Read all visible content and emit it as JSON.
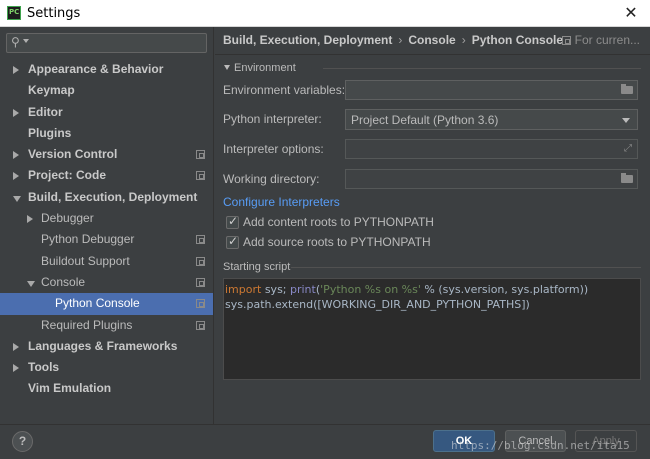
{
  "window": {
    "title": "Settings",
    "close_glyph": "✕"
  },
  "sidebar": {
    "search_placeholder": "",
    "items": [
      {
        "label": "Appearance & Behavior",
        "level": 0,
        "arrow": "right",
        "bold": true,
        "copy": false,
        "selected": false
      },
      {
        "label": "Keymap",
        "level": 0,
        "arrow": "none",
        "bold": true,
        "copy": false,
        "selected": false
      },
      {
        "label": "Editor",
        "level": 0,
        "arrow": "right",
        "bold": true,
        "copy": false,
        "selected": false
      },
      {
        "label": "Plugins",
        "level": 0,
        "arrow": "none",
        "bold": true,
        "copy": false,
        "selected": false
      },
      {
        "label": "Version Control",
        "level": 0,
        "arrow": "right",
        "bold": true,
        "copy": true,
        "selected": false
      },
      {
        "label": "Project: Code",
        "level": 0,
        "arrow": "right",
        "bold": true,
        "copy": true,
        "selected": false
      },
      {
        "label": "Build, Execution, Deployment",
        "level": 0,
        "arrow": "down",
        "bold": true,
        "copy": false,
        "selected": false
      },
      {
        "label": "Debugger",
        "level": 1,
        "arrow": "right",
        "bold": false,
        "copy": false,
        "selected": false
      },
      {
        "label": "Python Debugger",
        "level": 1,
        "arrow": "none",
        "bold": false,
        "copy": true,
        "selected": false
      },
      {
        "label": "Buildout Support",
        "level": 1,
        "arrow": "none",
        "bold": false,
        "copy": true,
        "selected": false
      },
      {
        "label": "Console",
        "level": 1,
        "arrow": "down",
        "bold": false,
        "copy": true,
        "selected": false
      },
      {
        "label": "Python Console",
        "level": 2,
        "arrow": "none",
        "bold": false,
        "copy": true,
        "selected": true
      },
      {
        "label": "Required Plugins",
        "level": 1,
        "arrow": "none",
        "bold": false,
        "copy": true,
        "selected": false
      },
      {
        "label": "Languages & Frameworks",
        "level": 0,
        "arrow": "right",
        "bold": true,
        "copy": false,
        "selected": false
      },
      {
        "label": "Tools",
        "level": 0,
        "arrow": "right",
        "bold": true,
        "copy": false,
        "selected": false
      },
      {
        "label": "Vim Emulation",
        "level": 0,
        "arrow": "none",
        "bold": true,
        "copy": false,
        "selected": false
      }
    ]
  },
  "breadcrumb": {
    "part1": "Build, Execution, Deployment",
    "part2": "Console",
    "part3": "Python Console",
    "separator": "›"
  },
  "for_current": "For curren...",
  "environment": {
    "section_title": "Environment",
    "env_vars_label": "Environment variables:",
    "env_vars_value": "",
    "interpreter_label": "Python interpreter:",
    "interpreter_value": "Project Default (Python 3.6)",
    "interpreter_options_label": "Interpreter options:",
    "interpreter_options_value": "",
    "working_dir_label": "Working directory:",
    "working_dir_value": "",
    "configure_link": "Configure Interpreters",
    "add_content_roots": {
      "label": "Add content roots to PYTHONPATH",
      "checked": true
    },
    "add_source_roots": {
      "label": "Add source roots to PYTHONPATH",
      "checked": true
    }
  },
  "starting_script": {
    "title": "Starting script",
    "line1": {
      "kw": "import",
      "sys": " sys; ",
      "fn": "print",
      "paren": "(",
      "str": "'Python %s on %s'",
      "rest": " % (sys.version, sys.platform))"
    },
    "line2": "sys.path.extend([WORKING_DIR_AND_PYTHON_PATHS])"
  },
  "footer": {
    "help": "?",
    "ok": "OK",
    "cancel": "Cancel",
    "apply": "Apply",
    "watermark": "https://blog.csdn.net/ita15"
  },
  "colors": {
    "selection": "#4b6eaf",
    "link": "#589df6",
    "keyword": "#cc7832",
    "string": "#6a8759",
    "builtin": "#8888c6"
  }
}
